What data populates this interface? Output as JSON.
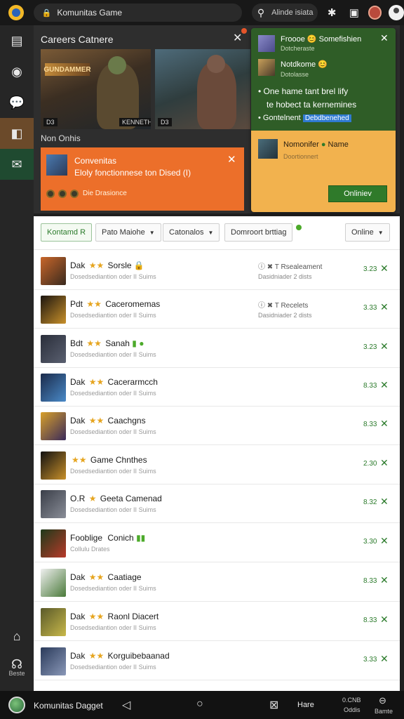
{
  "topbar": {
    "url_text": "Komunitas Game",
    "search_text": "Alinde isiata"
  },
  "sidebar": {
    "bottom_label": "Beste"
  },
  "panel": {
    "title": "Careers Catnere",
    "hero1_banner": "GUNDAMMER",
    "hero1_tag": "D3",
    "hero1_tag2": "KENNETH",
    "hero2_tag": "D3",
    "online_label": "Non Onhis"
  },
  "promo": {
    "line1": "Convenitas",
    "line2": "Eloly fonctionnese ton Dised (I)",
    "foot": "Die Drasionce"
  },
  "notification": {
    "item1_title": "Froooe",
    "item1_title2": "Somefishien",
    "item1_sub": "Dotcheraste",
    "item2_title": "Notdkome",
    "item2_sub": "Dotolasse",
    "bullet1": "One hame tant brel lify",
    "bullet2": "te hobect ta kernemines",
    "bullet3": "Gontelnent",
    "bullet3_link": "Debdbenehed",
    "card_title": "Nomonifer",
    "card_title2": "Name",
    "card_sub": "Doortionnert",
    "card_button": "Onliniev"
  },
  "filters": {
    "chip1": "Kontamd R",
    "chip2": "Pato Maiohe",
    "chip3": "Catonalos",
    "chip4": "Domroort brttiag",
    "chip5": "Online"
  },
  "rows": [
    {
      "title_a": "Dak",
      "stars": "★★",
      "title_b": "Sorsle",
      "badge": "🔒",
      "sub": "Dosedsediantion oder II Suims",
      "meta1": "ⓘ ✖ T Rsealeament",
      "meta2": "Dasidniader 2 dists",
      "time": "3.23",
      "thumb": "linear-gradient(135deg,#c8662a,#3a2a1e)"
    },
    {
      "title_a": "Pdt",
      "stars": "★★",
      "title_b": "Caceromemas",
      "badge": "",
      "sub": "Dosedsediantion oder II Suims",
      "meta1": "ⓘ ✖ T Recelets",
      "meta2": "Dasidniader 2 dists",
      "time": "3.33",
      "thumb": "linear-gradient(135deg,#1b1510,#c8902a)"
    },
    {
      "title_a": "Bdt",
      "stars": "★★",
      "title_b": "Sanah",
      "badge": "▮ ●",
      "sub": "Dosedsediantion oder II Suims",
      "meta1": "",
      "meta2": "",
      "time": "3.23",
      "thumb": "linear-gradient(135deg,#2a2e3a,#5a6070)"
    },
    {
      "title_a": "Dak",
      "stars": "★★",
      "title_b": "Cacerarmcch",
      "badge": "",
      "sub": "Dosedsediantion oder II Suims",
      "meta1": "",
      "meta2": "",
      "time": "8.33",
      "thumb": "linear-gradient(135deg,#1a2a4a,#4a8ac8)"
    },
    {
      "title_a": "Dak",
      "stars": "★★",
      "title_b": "Caachgns",
      "badge": "",
      "sub": "Dosedsediantion oder II Suims",
      "meta1": "",
      "meta2": "",
      "time": "8.33",
      "thumb": "linear-gradient(135deg,#d8a02a,#3a2a5a)"
    },
    {
      "title_a": "",
      "stars": "★★",
      "title_b": "Game Chnthes",
      "badge": "",
      "sub": "Dosedsediantion oder II Suims",
      "meta1": "",
      "meta2": "",
      "time": "2.30",
      "thumb": "linear-gradient(135deg,#111111,#c8902a)"
    },
    {
      "title_a": "O.R",
      "stars": "★",
      "title_b": "Geeta Camenad",
      "badge": "",
      "sub": "Dosedsediantion oder II Suims",
      "meta1": "",
      "meta2": "",
      "time": "8.32",
      "thumb": "linear-gradient(135deg,#3a3e48,#8a8e98)"
    },
    {
      "title_a": "Fooblige",
      "stars": "",
      "title_b": "Conich",
      "badge": "▮▮",
      "sub": "Collulu Drates",
      "meta1": "",
      "meta2": "",
      "time": "3.30",
      "thumb": "linear-gradient(135deg,#1e3a1a,#b83a2a)"
    },
    {
      "title_a": "Dak",
      "stars": "★★",
      "title_b": "Caatiage",
      "badge": "",
      "sub": "Dosedsediantion oder II Suims",
      "meta1": "",
      "meta2": "",
      "time": "8.33",
      "thumb": "linear-gradient(135deg,#f0f0f0,#4a7a3a)"
    },
    {
      "title_a": "Dak",
      "stars": "★★",
      "title_b": "Raonl Diacert",
      "badge": "",
      "sub": "Dosedsediantion oder II Suims",
      "meta1": "",
      "meta2": "",
      "time": "8.33",
      "thumb": "linear-gradient(135deg,#5a5a2a,#c8b84a)"
    },
    {
      "title_a": "Dak",
      "stars": "★★",
      "title_b": "Korguibebaanad",
      "badge": "",
      "sub": "Dosedsediantion oder II Suims",
      "meta1": "",
      "meta2": "",
      "time": "3.33",
      "thumb": "linear-gradient(135deg,#2a3a5a,#8a98b8)"
    }
  ],
  "navbar": {
    "label": "Komunitas Dagget",
    "text1": "Hare",
    "text2a": "0.CNB",
    "text2b": "Oddis",
    "text3": "Bamte"
  }
}
